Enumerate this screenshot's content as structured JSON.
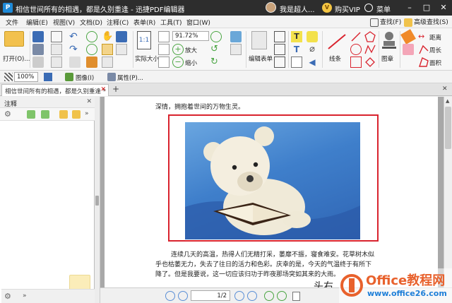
{
  "app": {
    "title": "相信世间所有的相遇，都是久别重逢 - 迅捷PDF编辑器",
    "icon_letter": "P",
    "user_name": "我是超人...",
    "vip_label": "购买VIP",
    "menu_label": "菜单"
  },
  "menubar": {
    "items": [
      "文件",
      "编辑(E)",
      "视图(V)",
      "文档(D)",
      "注释(C)",
      "表单(R)",
      "工具(T)",
      "窗口(W)"
    ],
    "find_label": "查找(F)",
    "advanced_find_label": "高级查找(S)"
  },
  "ribbon": {
    "open_label": "打开(O)...",
    "actual_size_label": "实际大小",
    "zoom_value": "91.72%",
    "zoom_in_label": "放大",
    "zoom_out_label": "缩小",
    "edit_form_label": "编辑表单",
    "line_label": "线条",
    "stamp_label": "图章",
    "distance_label": "距离",
    "perimeter_label": "周长",
    "area_label": "面积"
  },
  "toolbar2": {
    "zoom_value": "100%",
    "image_label": "图像(I)",
    "properties_label": "属性(P)..."
  },
  "tab": {
    "label": "相信世间所有的相遇，都是久别重逢 *"
  },
  "panel": {
    "title": "注释"
  },
  "document": {
    "line_top": "深情，拥抱着世间的万物生灵。",
    "para_line1": "连续几天的高温，热得人们无精打采，萎靡不振，寝食难安。花草树木似",
    "para_line2": "乎也枯萎无力，失去了往日的活力和色彩。庆幸的是，今天的气温终于有所下",
    "para_line3": "降了。但是我要说，这一切应该归功于昨夜那场突如其来的大雨。",
    "bottom_fragment": "头右"
  },
  "statusbar": {
    "page_value": "1/2"
  },
  "watermark": {
    "brand": "Office教程网",
    "url": "www.office26.com"
  },
  "colors": {
    "titlebar": "#2d2d2d",
    "highlight_border": "#d9232e",
    "watermark_orange": "#e8612c",
    "watermark_blue": "#1e7fd8"
  }
}
